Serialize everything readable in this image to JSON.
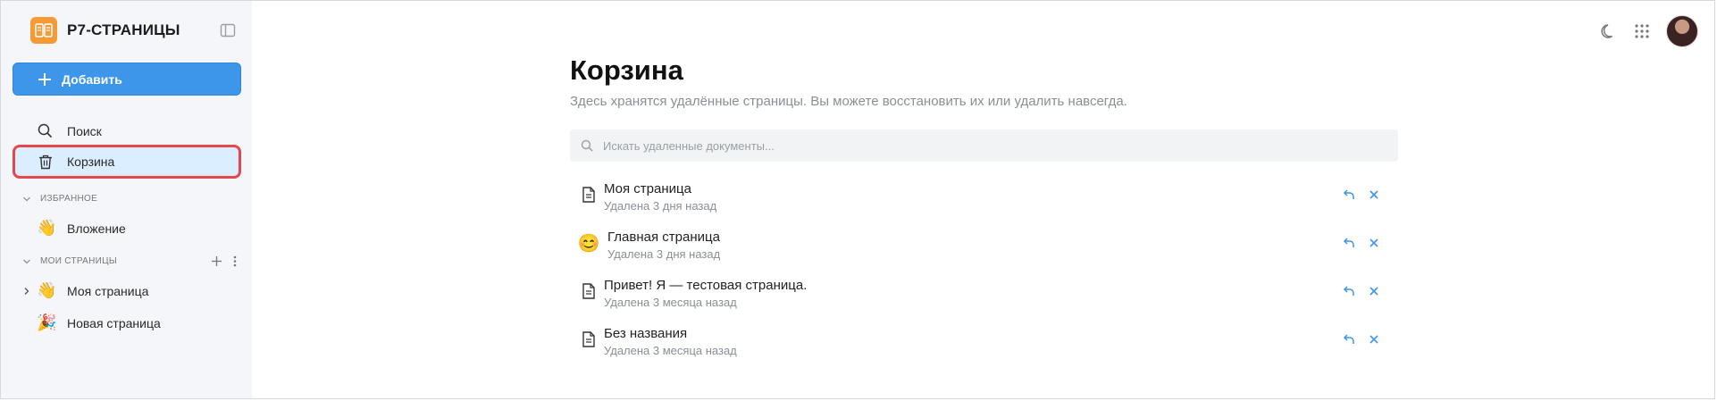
{
  "app": {
    "name": "Р7-СТРАНИЦЫ"
  },
  "sidebar": {
    "add_label": "Добавить",
    "search_label": "Поиск",
    "trash_label": "Корзина",
    "favorites": {
      "title": "ИЗБРАННОЕ",
      "items": [
        {
          "emoji": "👋",
          "label": "Вложение"
        }
      ]
    },
    "my_pages": {
      "title": "МОИ СТРАНИЦЫ",
      "items": [
        {
          "emoji": "👋",
          "label": "Моя страница"
        },
        {
          "emoji": "🎉",
          "label": "Новая страница"
        }
      ]
    }
  },
  "main": {
    "title": "Корзина",
    "subtitle": "Здесь хранятся удалённые страницы. Вы можете восстановить их или удалить навсегда.",
    "search_placeholder": "Искать удаленные документы...",
    "documents": [
      {
        "name": "Моя страница",
        "meta": "Удалена 3 дня назад",
        "icon": "document-icon"
      },
      {
        "name": "Главная страница",
        "meta": "Удалена 3 дня назад",
        "icon": "smile-emoji",
        "emoji": "😊"
      },
      {
        "name": "Привет! Я — тестовая страница.",
        "meta": "Удалена 3 месяца назад",
        "icon": "document-icon"
      },
      {
        "name": "Без названия",
        "meta": "Удалена 3 месяца назад",
        "icon": "document-icon"
      }
    ]
  },
  "colors": {
    "accent": "#3d96ea",
    "brand": "#f59a34",
    "highlight": "#e4474d",
    "sidebar_bg": "#f4f6f9"
  }
}
